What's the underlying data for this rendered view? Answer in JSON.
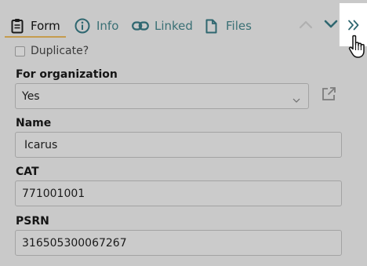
{
  "tabs": [
    {
      "label": "Form",
      "icon": "clipboard-icon",
      "active": true
    },
    {
      "label": "Info",
      "icon": "info-circle-icon",
      "active": false
    },
    {
      "label": "Linked",
      "icon": "link-icon",
      "active": false
    },
    {
      "label": "Files",
      "icon": "file-icon",
      "active": false
    }
  ],
  "nav": {
    "prev_icon": "chevron-up-icon",
    "next_icon": "chevron-down-icon",
    "expand_icon": "double-chevron-right-icon"
  },
  "form": {
    "duplicate_label": "Duplicate?",
    "duplicate_checked": false,
    "org_label": "For organization",
    "org_value": "Yes",
    "name_label": "Name",
    "name_value": "Icarus",
    "cat_label": "CAT",
    "cat_value": "771001001",
    "psrn_label": "PSRN",
    "psrn_value": "316505300067267"
  },
  "colors": {
    "accent": "#c59c4e",
    "tab_text": "#3a7075",
    "nav_active": "#2f6770",
    "nav_disabled": "#b0b0b0",
    "background": "#c9c9c9"
  }
}
